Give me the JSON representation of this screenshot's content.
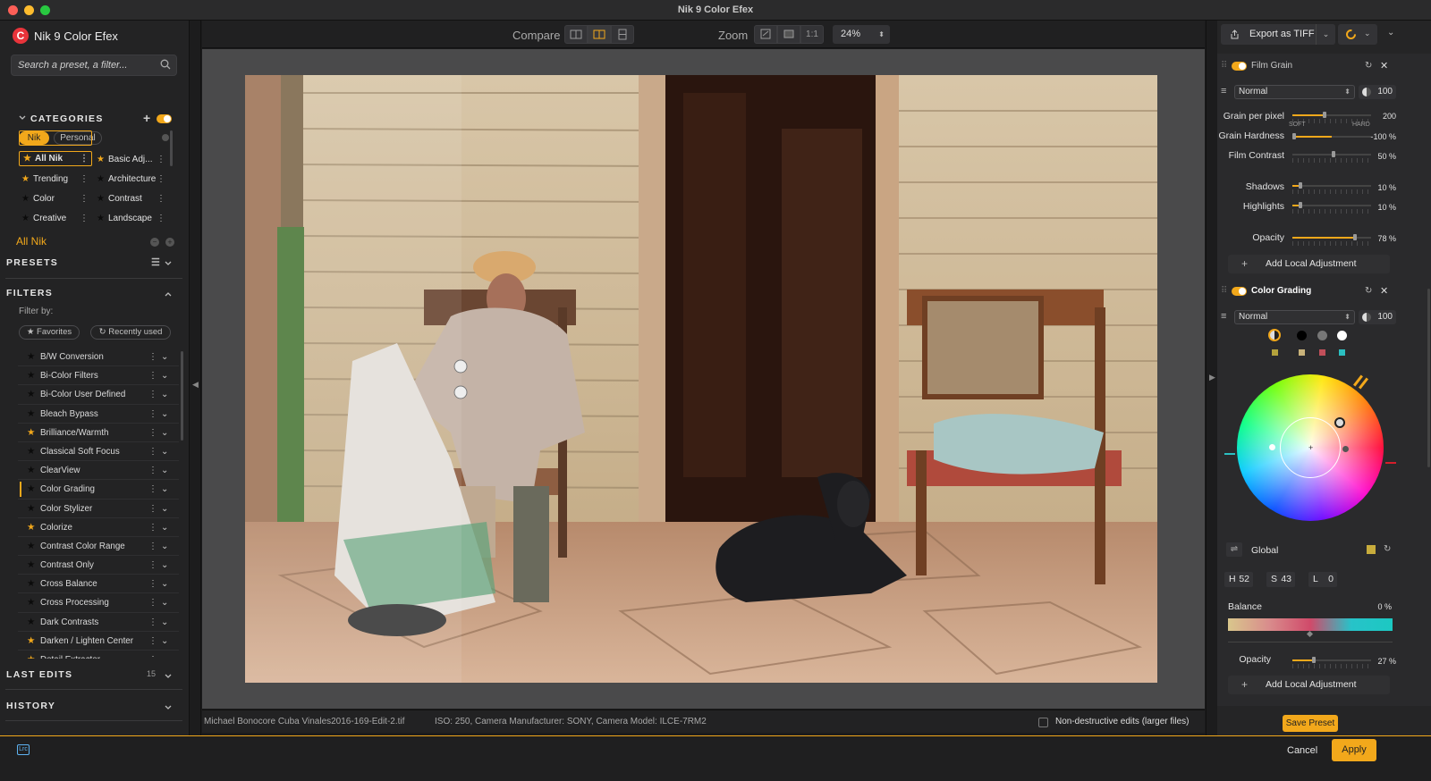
{
  "window": {
    "title": "Nik 9 Color Efex"
  },
  "app": {
    "name": "Nik 9 Color Efex"
  },
  "search": {
    "placeholder": "Search a preset, a filter..."
  },
  "categories": {
    "heading": "CATEGORIES",
    "tabs": [
      "Nik",
      "Personal"
    ],
    "items": [
      {
        "label": "All Nik",
        "starred": true
      },
      {
        "label": "Basic Adj...",
        "starred": true
      },
      {
        "label": "Trending",
        "starred": true
      },
      {
        "label": "Architecture",
        "starred": false
      },
      {
        "label": "Color",
        "starred": false
      },
      {
        "label": "Contrast",
        "starred": false
      },
      {
        "label": "Creative",
        "starred": false
      },
      {
        "label": "Landscape",
        "starred": false
      }
    ],
    "current": "All Nik"
  },
  "presets": {
    "heading": "PRESETS"
  },
  "filters": {
    "heading": "FILTERS",
    "filter_by": "Filter by:",
    "favorites": "Favorites",
    "recently_used": "Recently used",
    "items": [
      {
        "label": "B/W Conversion",
        "fav": false
      },
      {
        "label": "Bi-Color Filters",
        "fav": false
      },
      {
        "label": "Bi-Color User Defined",
        "fav": false
      },
      {
        "label": "Bleach Bypass",
        "fav": false
      },
      {
        "label": "Brilliance/Warmth",
        "fav": true
      },
      {
        "label": "Classical Soft Focus",
        "fav": false
      },
      {
        "label": "ClearView",
        "fav": false
      },
      {
        "label": "Color Grading",
        "fav": false,
        "active": true
      },
      {
        "label": "Color Stylizer",
        "fav": false
      },
      {
        "label": "Colorize",
        "fav": true
      },
      {
        "label": "Contrast Color Range",
        "fav": false
      },
      {
        "label": "Contrast Only",
        "fav": false
      },
      {
        "label": "Cross Balance",
        "fav": false
      },
      {
        "label": "Cross Processing",
        "fav": false
      },
      {
        "label": "Dark Contrasts",
        "fav": false
      },
      {
        "label": "Darken / Lighten Center",
        "fav": true
      },
      {
        "label": "Detail Extractor",
        "fav": true
      }
    ]
  },
  "last_edits": {
    "heading": "LAST EDITS",
    "count": "15"
  },
  "history": {
    "heading": "HISTORY"
  },
  "toolbar": {
    "compare_label": "Compare",
    "zoom_label": "Zoom",
    "one_to_one": "1:1",
    "zoom_value": "24%"
  },
  "status": {
    "file": "Michael Bonocore Cuba Vinales2016-169-Edit-2.tif",
    "meta": "ISO: 250, Camera Manufacturer: SONY, Camera Model: ILCE-7RM2",
    "nondestructive": "Non-destructive edits (larger files)"
  },
  "export": {
    "label": "Export as TIFF"
  },
  "film_grain": {
    "title": "Film Grain",
    "blend_mode": "Normal",
    "opacity_box": "100",
    "grain_per_pixel": {
      "label": "Grain per pixel",
      "value": "200"
    },
    "grain_hardness": {
      "label": "Grain Hardness",
      "value": "-100 %",
      "soft": "SOFT",
      "hard": "HARD"
    },
    "film_contrast": {
      "label": "Film Contrast",
      "value": "50 %"
    },
    "shadows": {
      "label": "Shadows",
      "value": "10 %"
    },
    "highlights": {
      "label": "Highlights",
      "value": "10 %"
    },
    "opacity": {
      "label": "Opacity",
      "value": "78 %"
    },
    "add_local": "Add Local Adjustment"
  },
  "color_grading": {
    "title": "Color Grading",
    "blend_mode": "Normal",
    "opacity_box": "100",
    "global_label": "Global",
    "h_label": "H",
    "h_value": "52",
    "s_label": "S",
    "s_value": "43",
    "l_label": "L",
    "l_value": "0",
    "balance": {
      "label": "Balance",
      "value": "0 %"
    },
    "opacity": {
      "label": "Opacity",
      "value": "27 %"
    },
    "add_local": "Add Local Adjustment"
  },
  "actions": {
    "save_preset": "Save Preset",
    "cancel": "Cancel",
    "apply": "Apply",
    "lrc": "Lrc"
  },
  "colors": {
    "accent": "#f2a81b",
    "brand_red": "#e8343b"
  }
}
